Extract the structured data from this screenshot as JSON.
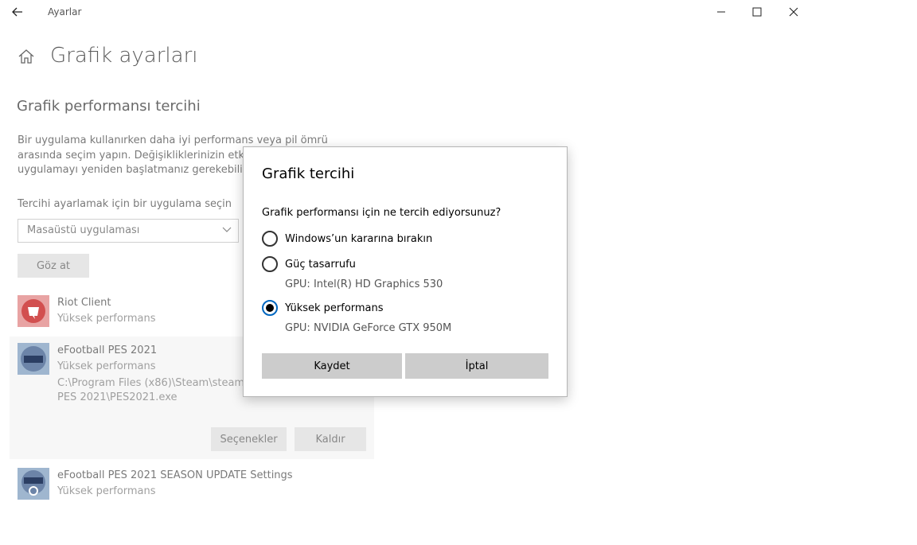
{
  "window": {
    "title": "Ayarlar"
  },
  "page": {
    "title": "Grafik ayarları",
    "section_title": "Grafik performansı tercihi",
    "description": "Bir uygulama kullanırken daha iyi performans veya pil ömrü arasında seçim yapın. Değişikliklerinizin etkili olması için uygulamayı yeniden başlatmanız gerekebilir.",
    "select_label": "Tercihi ayarlamak için bir uygulama seçin",
    "select_value": "Masaüstü uygulaması",
    "browse_label": "Göz at"
  },
  "apps": [
    {
      "name": "Riot Client",
      "preference": "Yüksek performans"
    },
    {
      "name": "eFootball PES 2021",
      "preference": "Yüksek performans",
      "path": "C:\\Program Files (x86)\\Steam\\steamapps\\common\\eFootball PES 2021\\PES2021.exe",
      "path_line1": "C:\\Program Files (x86)\\Steam\\steamap",
      "path_line2": "PES 2021\\PES2021.exe"
    },
    {
      "name": "eFootball PES 2021 SEASON UPDATE Settings",
      "preference": "Yüksek performans"
    }
  ],
  "selected_app_actions": {
    "options_label": "Seçenekler",
    "remove_label": "Kaldır"
  },
  "dialog": {
    "title": "Grafik tercihi",
    "question": "Grafik performansı için ne tercih ediyorsunuz?",
    "options": [
      {
        "label": "Windows’un kararına bırakın",
        "checked": false
      },
      {
        "label": "Güç tasarrufu",
        "gpu": "GPU: Intel(R) HD Graphics 530",
        "checked": false
      },
      {
        "label": "Yüksek performans",
        "gpu": "GPU: NVIDIA GeForce GTX 950M",
        "checked": true
      }
    ],
    "save_label": "Kaydet",
    "cancel_label": "İptal"
  },
  "icons": {
    "back": "back-arrow-icon",
    "home": "home-icon",
    "minimize": "minimize-icon",
    "maximize": "maximize-icon",
    "close": "close-icon",
    "chevron": "chevron-down-icon"
  },
  "colors": {
    "accent": "#0067c0",
    "dialog_button": "#cccccc",
    "disabled_button": "#e6e6e6"
  }
}
